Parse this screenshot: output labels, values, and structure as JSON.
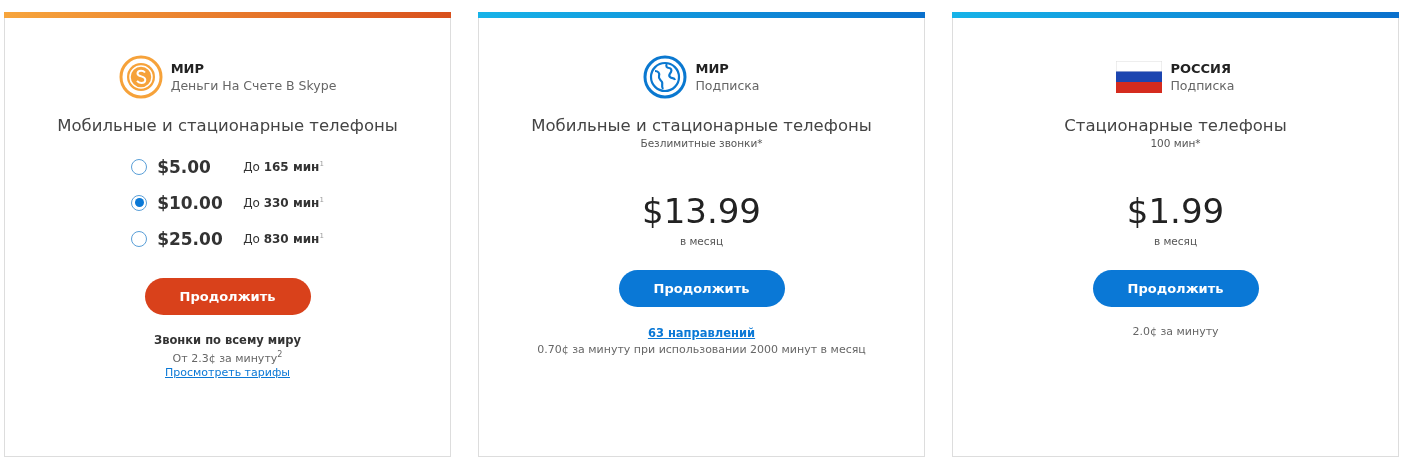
{
  "plans": [
    {
      "kind": "credit",
      "region": "МИР",
      "type": "Деньги На Счете В Skype",
      "title": "Мобильные и стационарные телефоны",
      "options": [
        {
          "price": "$5.00",
          "minutes": "До **165 мин**$^{1}$",
          "selected": false
        },
        {
          "price": "$10.00",
          "minutes": "До **330 мин**$^{1}$",
          "selected": true
        },
        {
          "price": "$25.00",
          "minutes": "До **830 мин**$^{1}$",
          "selected": false
        }
      ],
      "button": "Продолжить",
      "footer_title": "Звонки по всему миру",
      "footer_rate": "От 2.3¢ за минуту$^{2}$",
      "footer_link": "Просмотреть тарифы"
    },
    {
      "kind": "subscription",
      "region": "МИР",
      "type": "Подписка",
      "title": "Мобильные и стационарные телефоны",
      "subtitle": "Безлимитные звонки*",
      "price": "$13.99",
      "period": "в месяц",
      "button": "Продолжить",
      "link": "63 направлений",
      "note": "0.70¢ за минуту при использовании 2000 минут в месяц"
    },
    {
      "kind": "subscription",
      "region": "РОССИЯ",
      "type": "Подписка",
      "title": "Стационарные телефоны",
      "subtitle": "100 мин*",
      "price": "$1.99",
      "period": "в месяц",
      "button": "Продолжить",
      "note": "2.0¢ за минуту"
    }
  ]
}
